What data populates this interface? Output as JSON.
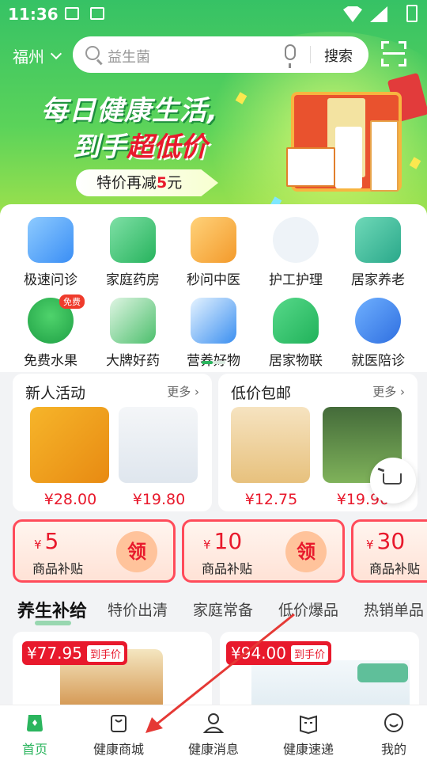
{
  "status": {
    "time": "11:36"
  },
  "header": {
    "city": "福州",
    "search_placeholder": "益生菌",
    "search_button": "搜索"
  },
  "banner": {
    "line1": "每日健康生活,",
    "line2_prefix": "到手",
    "line2_highlight": "超低价",
    "promo_prefix": "特价再减",
    "promo_number": "5",
    "promo_suffix": "元"
  },
  "services": [
    {
      "label": "极速问诊"
    },
    {
      "label": "家庭药房"
    },
    {
      "label": "秒问中医"
    },
    {
      "label": "护工护理"
    },
    {
      "label": "居家养老"
    },
    {
      "label": "免费水果",
      "badge": "免费"
    },
    {
      "label": "大牌好药"
    },
    {
      "label": "营养好物"
    },
    {
      "label": "居家物联"
    },
    {
      "label": "就医陪诊"
    }
  ],
  "deals": [
    {
      "title": "新人活动",
      "more": "更多 ›",
      "prices": [
        "¥28.00",
        "¥19.80"
      ]
    },
    {
      "title": "低价包邮",
      "more": "更多 ›",
      "prices": [
        "¥12.75",
        "¥19.90"
      ]
    }
  ],
  "coupons": [
    {
      "currency": "¥",
      "amount": "5",
      "label": "商品补贴",
      "action": "领"
    },
    {
      "currency": "¥",
      "amount": "10",
      "label": "商品补贴",
      "action": "领"
    },
    {
      "currency": "¥",
      "amount": "30",
      "label": "商品补贴"
    }
  ],
  "tabs": [
    "养生补给",
    "特价出清",
    "家庭常备",
    "低价爆品",
    "热销单品"
  ],
  "feed": [
    {
      "price": "¥77.95",
      "tag": "到手价"
    },
    {
      "price": "¥94.00",
      "tag": "到手价"
    }
  ],
  "nav": [
    {
      "label": "首页"
    },
    {
      "label": "健康商城"
    },
    {
      "label": "健康消息"
    },
    {
      "label": "健康速递"
    },
    {
      "label": "我的"
    }
  ],
  "colors": {
    "brand_green": "#2bb55e",
    "price_red": "#e8192c",
    "annotation_red": "#e53935"
  }
}
